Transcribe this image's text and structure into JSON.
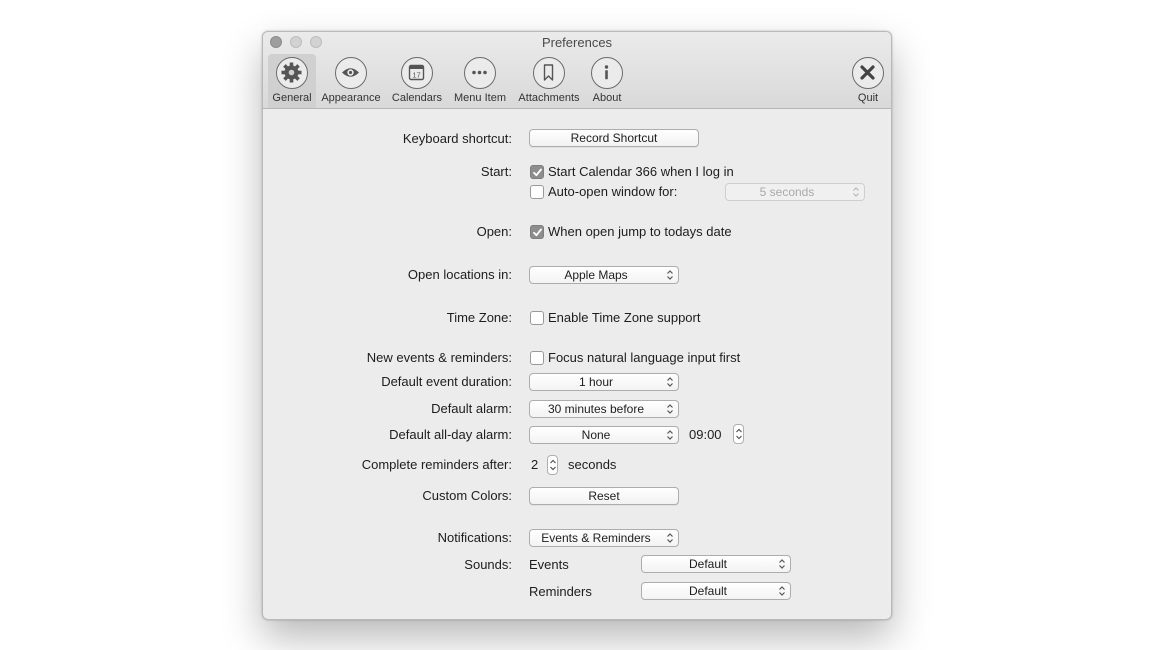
{
  "window": {
    "title": "Preferences"
  },
  "toolbar": {
    "general": "General",
    "appearance": "Appearance",
    "calendars": "Calendars",
    "calendar_day": "17",
    "menu_item": "Menu Item",
    "attachments": "Attachments",
    "about": "About",
    "quit": "Quit"
  },
  "general": {
    "keyboard_shortcut_label": "Keyboard shortcut:",
    "record_shortcut_button": "Record Shortcut",
    "start_label": "Start:",
    "start_at_login": {
      "label": "Start Calendar 366 when I log in",
      "checked": true
    },
    "auto_open": {
      "label": "Auto-open window for:",
      "checked": false,
      "value": "5 seconds"
    },
    "open_label": "Open:",
    "jump_to_today": {
      "label": "When open jump to todays date",
      "checked": true
    },
    "open_locations_label": "Open locations in:",
    "open_locations_value": "Apple Maps",
    "time_zone_label": "Time Zone:",
    "time_zone_support": {
      "label": "Enable Time Zone support",
      "checked": false
    },
    "new_events_label": "New events & reminders:",
    "focus_nl_input": {
      "label": "Focus natural language input first",
      "checked": false
    },
    "default_duration_label": "Default event duration:",
    "default_duration_value": "1 hour",
    "default_alarm_label": "Default alarm:",
    "default_alarm_value": "30 minutes before",
    "default_allday_alarm_label": "Default all-day alarm:",
    "default_allday_alarm_value": "None",
    "default_allday_alarm_time": "09:00",
    "complete_reminders_label": "Complete reminders after:",
    "complete_reminders_value": "2",
    "complete_reminders_unit": "seconds",
    "custom_colors_label": "Custom Colors:",
    "reset_button": "Reset",
    "notifications_label": "Notifications:",
    "notifications_value": "Events & Reminders",
    "sounds_label": "Sounds:",
    "sound_events_label": "Events",
    "sound_events_value": "Default",
    "sound_reminders_label": "Reminders",
    "sound_reminders_value": "Default"
  },
  "colors": {
    "checkbox_checked": "#8e8e8e",
    "window_bg": "#ececec",
    "selected_tab": "#d0d0d0"
  }
}
